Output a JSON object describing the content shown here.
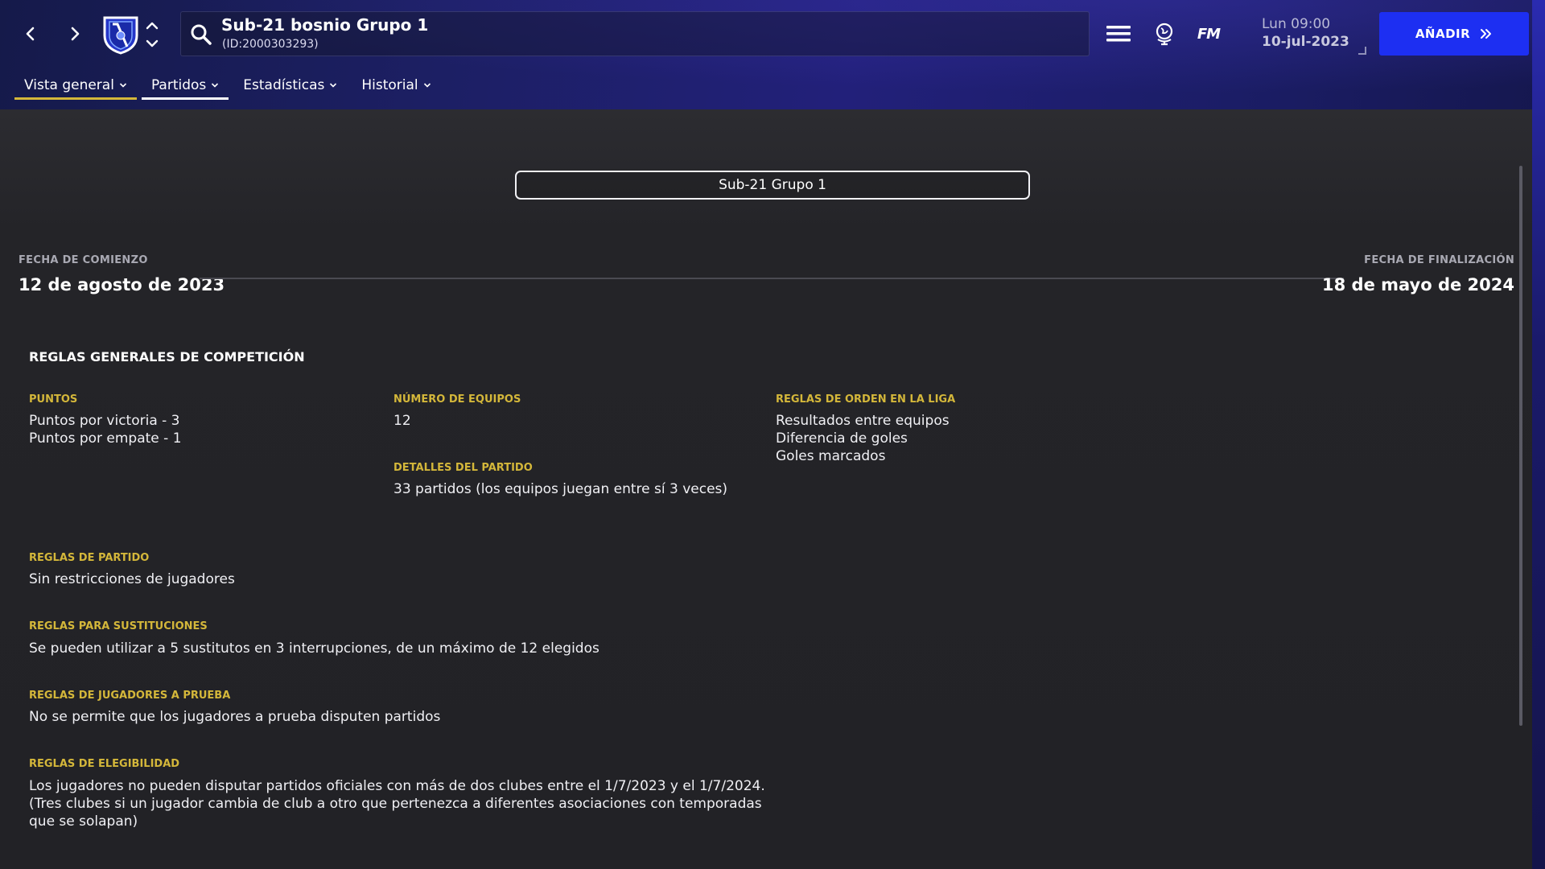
{
  "header": {
    "title": "Sub-21 bosnio Grupo 1",
    "subtitle": "(ID:2000303293)",
    "fm_label": "FM",
    "datetime_time": "Lun 09:00",
    "datetime_date": "10-jul-2023",
    "add_button_label": "AÑADIR"
  },
  "tabs": [
    {
      "label": "Vista general"
    },
    {
      "label": "Partidos"
    },
    {
      "label": "Estadísticas"
    },
    {
      "label": "Historial"
    }
  ],
  "competition": {
    "stage_button": "Sub-21 Grupo 1",
    "start_label": "FECHA DE COMIENZO",
    "start_value": "12 de agosto de 2023",
    "end_label": "FECHA DE FINALIZACIÓN",
    "end_value": "18 de mayo de 2024"
  },
  "rules": {
    "section_title": "REGLAS GENERALES DE COMPETICIÓN",
    "points_label": "PUNTOS",
    "points_lines": [
      "Puntos por victoria - 3",
      "Puntos por empate - 1"
    ],
    "teams_label": "NÚMERO DE EQUIPOS",
    "teams_value": "12",
    "match_details_label": "DETALLES DEL PARTIDO",
    "match_details_value": "33 partidos (los equipos juegan entre sí 3 veces)",
    "order_label": "REGLAS DE ORDEN EN LA LIGA",
    "order_lines": [
      "Resultados entre equipos",
      "Diferencia de goles",
      "Goles marcados"
    ],
    "match_rules_label": "REGLAS DE PARTIDO",
    "match_rules_value": "Sin restricciones de jugadores",
    "subs_label": "REGLAS PARA SUSTITUCIONES",
    "subs_value": "Se pueden utilizar a 5 sustitutos en 3 interrupciones, de un máximo de 12 elegidos",
    "trial_label": "REGLAS DE JUGADORES A PRUEBA",
    "trial_value": "No se permite que los jugadores a prueba disputen partidos",
    "eligibility_label": "REGLAS DE ELEGIBILIDAD",
    "eligibility_lines": [
      "Los jugadores no pueden disputar partidos oficiales con más de dos clubes entre el 1/7/2023 y el 1/7/2024.",
      "(Tres clubes si un jugador cambia de club a otro que pertenezca a diferentes asociaciones con temporadas",
      "que se solapan)"
    ]
  },
  "colors": {
    "accent_gold": "#d4b73a",
    "add_button_blue": "#1d2ff2",
    "topbar_navy": "#1c1f63",
    "content_bg": "#232327"
  },
  "icons": {
    "back": "chevron-left-icon",
    "forward": "chevron-right-icon",
    "crest": "club-crest-icon",
    "search": "search-icon",
    "menu": "hamburger-menu-icon",
    "world": "globe-icon",
    "add": "double-chevron-right-icon"
  }
}
